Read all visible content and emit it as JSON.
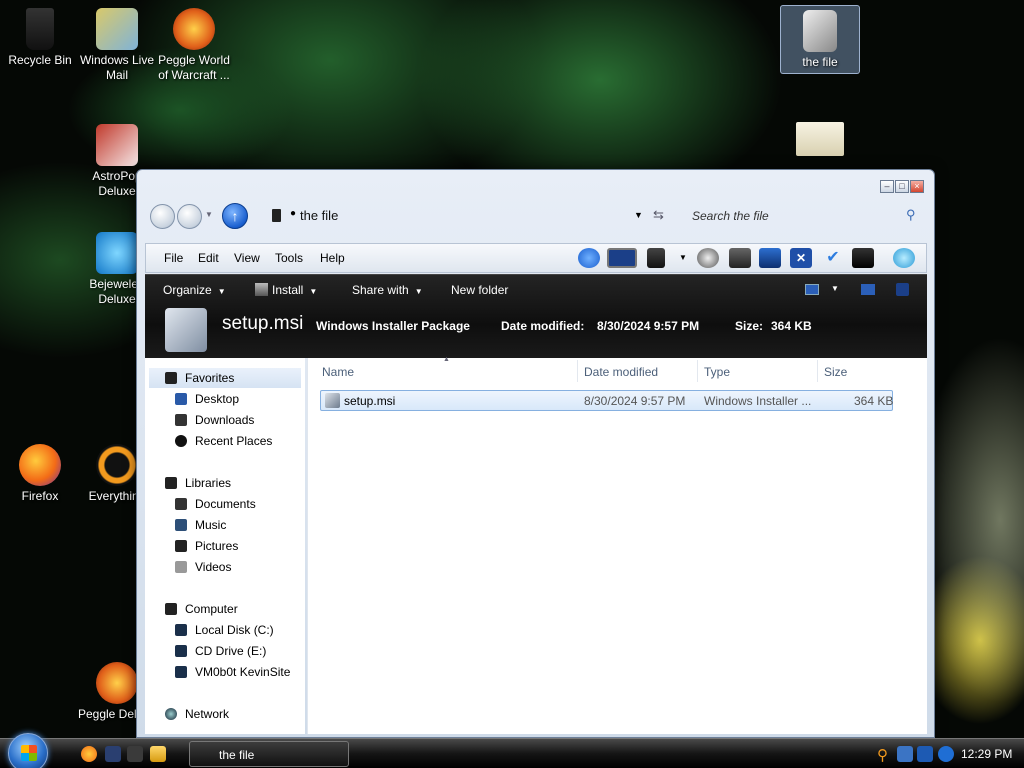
{
  "desktop": {
    "icons": [
      {
        "label": "Recycle Bin"
      },
      {
        "label": "Windows Live Mail"
      },
      {
        "label": "Peggle World of Warcraft ..."
      },
      {
        "label": "the file"
      },
      {
        "label": "AstroPop Deluxe"
      },
      {
        "label": "Bejeweled Deluxe"
      },
      {
        "label": "Firefox"
      },
      {
        "label": "Everything"
      },
      {
        "label": "Peggle Deluxe"
      }
    ]
  },
  "window": {
    "breadcrumb": "the file",
    "search_placeholder": "Search the file",
    "controls": {
      "minimize": "–",
      "maximize": "□",
      "close": "×"
    },
    "menu": [
      "File",
      "Edit",
      "View",
      "Tools",
      "Help"
    ],
    "commands": {
      "organize": "Organize",
      "install": "Install",
      "share_with": "Share with",
      "new_folder": "New folder"
    },
    "details": {
      "file_name": "setup.msi",
      "file_type": "Windows Installer Package",
      "date_label": "Date modified:",
      "date_value": "8/30/2024 9:57 PM",
      "size_label": "Size:",
      "size_value": "364 KB"
    },
    "navpane": {
      "favorites": "Favorites",
      "desktop": "Desktop",
      "downloads": "Downloads",
      "recent_places": "Recent Places",
      "libraries": "Libraries",
      "documents": "Documents",
      "music": "Music",
      "pictures": "Pictures",
      "videos": "Videos",
      "computer": "Computer",
      "local_disk": "Local Disk (C:)",
      "cd_drive": "CD Drive (E:)",
      "network_drive": "VM0b0t KevinSite",
      "network": "Network"
    },
    "columns": {
      "name": "Name",
      "date_modified": "Date modified",
      "type": "Type",
      "size": "Size"
    },
    "files": [
      {
        "name": "setup.msi",
        "date_modified": "8/30/2024 9:57 PM",
        "type": "Windows Installer ...",
        "size": "364 KB"
      }
    ]
  },
  "taskbar": {
    "task_button": "the file",
    "clock": "12:29 PM"
  },
  "colors": {
    "accent": "#1a5fcf",
    "command_bar": "#111111",
    "selection": "#d8e8fa"
  }
}
